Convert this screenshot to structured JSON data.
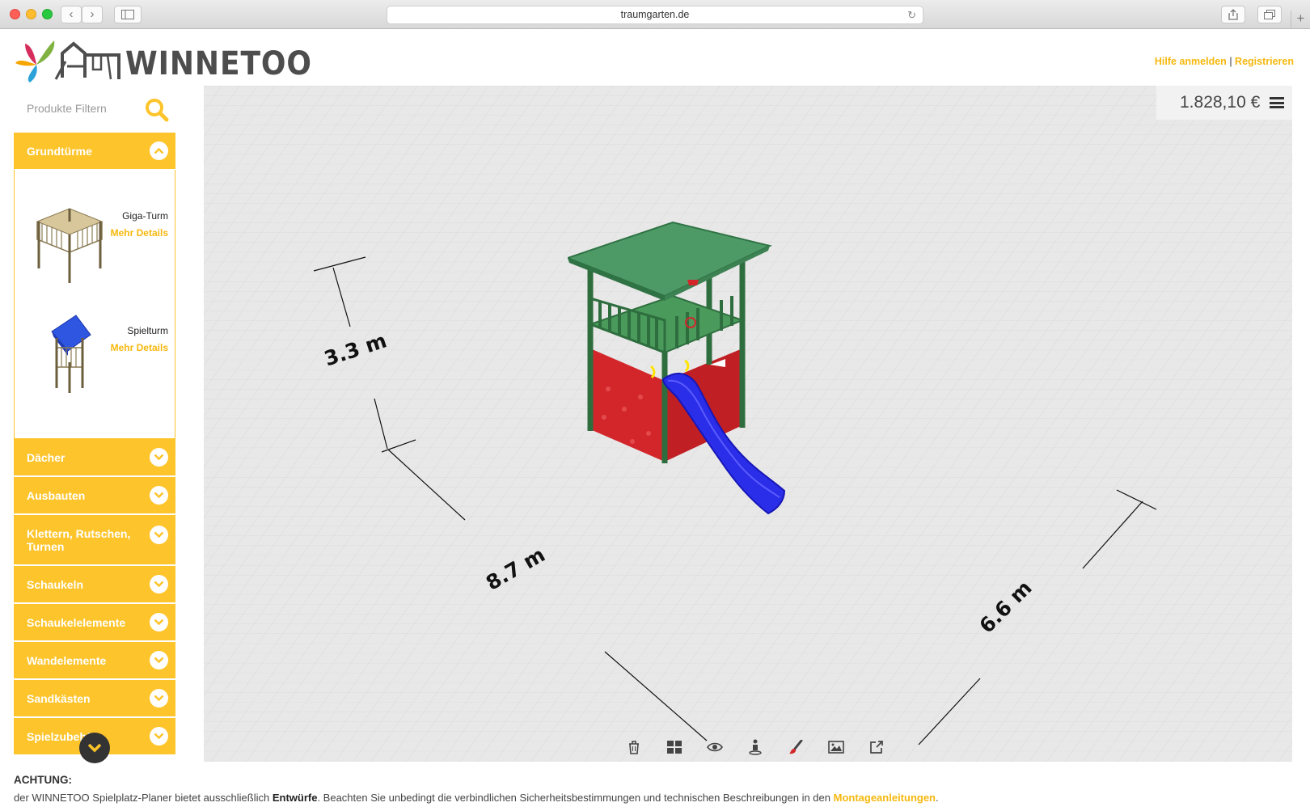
{
  "browser": {
    "url": "traumgarten.de",
    "back_icon": "chevron-left-icon",
    "forward_icon": "chevron-right-icon",
    "sidebar_icon": "sidebar-icon",
    "share_icon": "share-icon",
    "tabs_icon": "tabs-icon",
    "reload_icon": "reload-icon"
  },
  "header": {
    "logo_text": "WINNETOO",
    "help_link": "Hilfe anmelden",
    "separator": "|",
    "register_link": "Registrieren",
    "accent_color": "#f6b80f"
  },
  "sidebar": {
    "filter_placeholder": "Produkte Filtern",
    "expanded_category": {
      "label": "Grundtürme",
      "products": [
        {
          "name": "Giga-Turm",
          "details_link": "Mehr Details"
        },
        {
          "name": "Spielturm",
          "details_link": "Mehr Details"
        }
      ]
    },
    "categories": [
      {
        "label": "Dächer"
      },
      {
        "label": "Ausbauten"
      },
      {
        "label": "Klettern, Rutschen, Turnen"
      },
      {
        "label": "Schaukeln"
      },
      {
        "label": "Schaukelelemente"
      },
      {
        "label": "Wandelemente"
      },
      {
        "label": "Sandkästen"
      },
      {
        "label": "Spielzubehör"
      }
    ],
    "category_color": "#fdc42b"
  },
  "canvas": {
    "price": "1.828,10 €",
    "dimensions": {
      "height": "3.3 m",
      "length": "8.7 m",
      "width": "6.6 m"
    },
    "toolbar": [
      {
        "name": "trash-icon"
      },
      {
        "name": "grid-view-icon"
      },
      {
        "name": "eye-icon"
      },
      {
        "name": "person-icon"
      },
      {
        "name": "paint-brush-icon"
      },
      {
        "name": "image-icon"
      },
      {
        "name": "external-link-icon"
      }
    ]
  },
  "footer": {
    "warning_title": "ACHTUNG:",
    "warning_prefix": "der WINNETOO Spielplatz-Planer bietet ausschließlich ",
    "warning_bold": "Entwürfe",
    "warning_middle": ". Beachten Sie unbedingt die verbindlichen Sicherheitsbestimmungen und technischen Beschreibungen in den ",
    "warning_link": "Montageanleitungen",
    "warning_end": "."
  }
}
